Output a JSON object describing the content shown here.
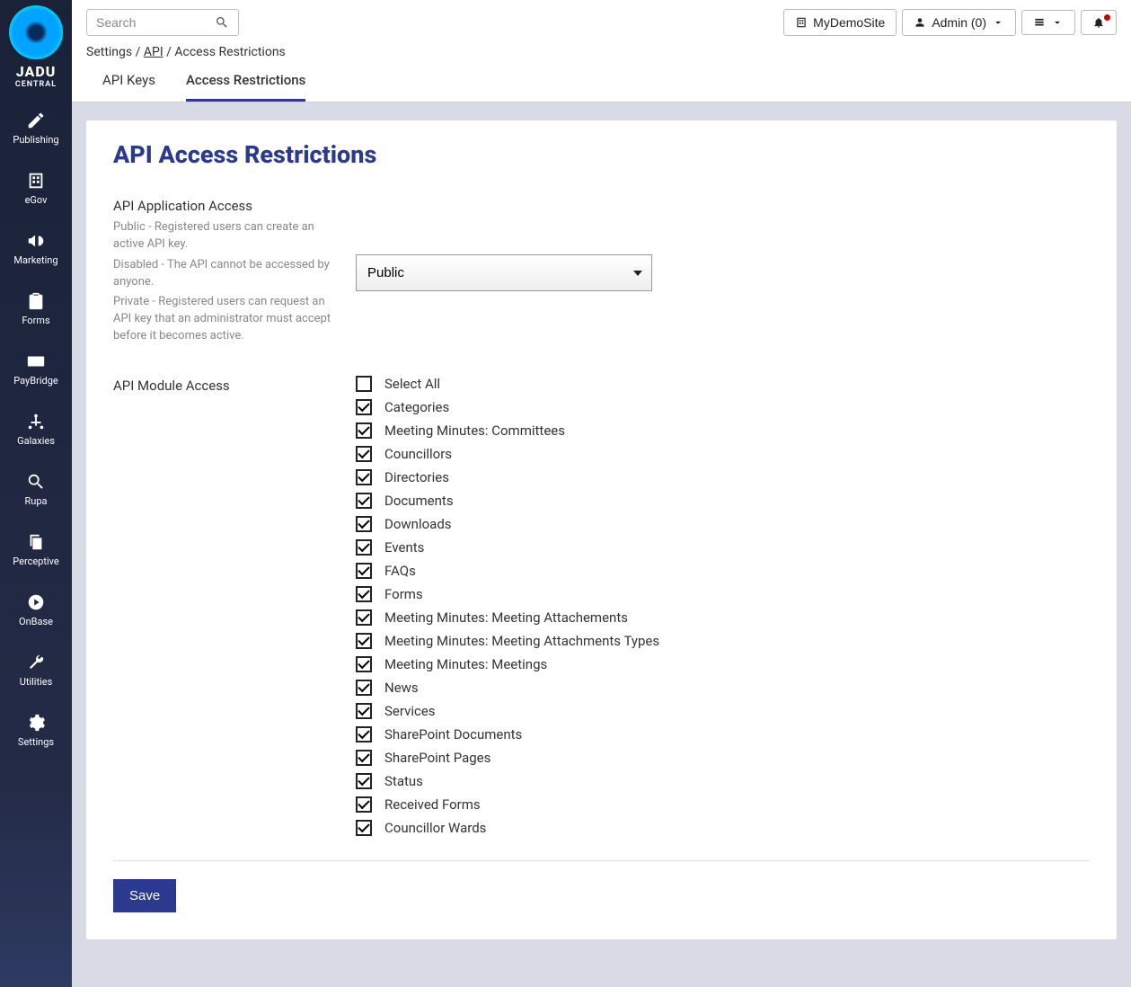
{
  "brand": {
    "name": "JADU",
    "sub": "CENTRAL"
  },
  "sidebar": {
    "items": [
      {
        "label": "Publishing",
        "icon": "pencil"
      },
      {
        "label": "eGov",
        "icon": "building"
      },
      {
        "label": "Marketing",
        "icon": "bullhorn"
      },
      {
        "label": "Forms",
        "icon": "clipboard"
      },
      {
        "label": "PayBridge",
        "icon": "card"
      },
      {
        "label": "Galaxies",
        "icon": "network"
      },
      {
        "label": "Rupa",
        "icon": "search"
      },
      {
        "label": "Perceptive",
        "icon": "copy"
      },
      {
        "label": "OnBase",
        "icon": "play"
      },
      {
        "label": "Utilities",
        "icon": "wrench"
      },
      {
        "label": "Settings",
        "icon": "gear"
      }
    ]
  },
  "search": {
    "placeholder": "Search"
  },
  "breadcrumb": {
    "a": "Settings",
    "b": "API",
    "c": "Access Restrictions"
  },
  "topbar": {
    "site": "MyDemoSite",
    "admin": "Admin (0)"
  },
  "tabs": [
    {
      "label": "API Keys",
      "active": false
    },
    {
      "label": "Access Restrictions",
      "active": true
    }
  ],
  "page": {
    "title": "API Access Restrictions",
    "app_access_label": "API Application Access",
    "help1": "Public - Registered users can create an active API key.",
    "help2": "Disabled - The API cannot be accessed by anyone.",
    "help3": "Private - Registered users can request an API key that an administrator must accept before it becomes active.",
    "app_access_value": "Public",
    "module_access_label": "API Module Access",
    "save_label": "Save"
  },
  "modules": [
    {
      "label": "Select All",
      "checked": false
    },
    {
      "label": "Categories",
      "checked": true
    },
    {
      "label": "Meeting Minutes: Committees",
      "checked": true
    },
    {
      "label": "Councillors",
      "checked": true
    },
    {
      "label": "Directories",
      "checked": true
    },
    {
      "label": "Documents",
      "checked": true
    },
    {
      "label": "Downloads",
      "checked": true
    },
    {
      "label": "Events",
      "checked": true
    },
    {
      "label": "FAQs",
      "checked": true
    },
    {
      "label": "Forms",
      "checked": true
    },
    {
      "label": "Meeting Minutes: Meeting Attachements",
      "checked": true
    },
    {
      "label": "Meeting Minutes: Meeting Attachments Types",
      "checked": true
    },
    {
      "label": "Meeting Minutes: Meetings",
      "checked": true
    },
    {
      "label": "News",
      "checked": true
    },
    {
      "label": "Services",
      "checked": true
    },
    {
      "label": "SharePoint Documents",
      "checked": true
    },
    {
      "label": "SharePoint Pages",
      "checked": true
    },
    {
      "label": "Status",
      "checked": true
    },
    {
      "label": "Received Forms",
      "checked": true
    },
    {
      "label": "Councillor Wards",
      "checked": true
    }
  ]
}
